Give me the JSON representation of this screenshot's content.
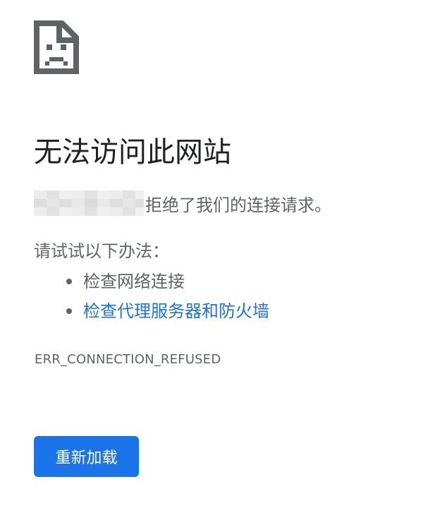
{
  "error_page": {
    "icon": "sad-document-icon",
    "title": "无法访问此网站",
    "detail": {
      "host_redacted": true,
      "message": "拒绝了我们的连接请求。"
    },
    "suggestions_heading": "请试试以下办法：",
    "suggestions": [
      {
        "label": "检查网络连接",
        "is_link": false
      },
      {
        "label": "检查代理服务器和防火墙",
        "is_link": true
      }
    ],
    "error_code": "ERR_CONNECTION_REFUSED",
    "reload_label": "重新加载"
  },
  "colors": {
    "title": "#202124",
    "body_text": "#5f6368",
    "link": "#1a73e8",
    "button_bg": "#1a73e8",
    "button_text": "#ffffff",
    "icon": "#5f6368"
  }
}
